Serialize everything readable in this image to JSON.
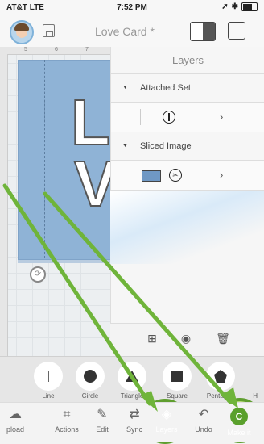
{
  "status_bar": {
    "carrier": "AT&T LTE",
    "time": "7:52 PM"
  },
  "header": {
    "title": "Love Card *"
  },
  "ruler": {
    "marks": [
      "5",
      "6",
      "7"
    ]
  },
  "canvas": {
    "letters": [
      "L",
      "V"
    ]
  },
  "layers_panel": {
    "title": "Layers",
    "groups": [
      {
        "label": "Attached Set"
      },
      {
        "label": "Sliced Image"
      }
    ]
  },
  "shapes": [
    "Line",
    "Circle",
    "Triangle",
    "Square",
    "Pentagon",
    "H"
  ],
  "toolbar": [
    "pload",
    "Actions",
    "Edit",
    "Sync",
    "Layers",
    "Undo",
    "Make it"
  ],
  "colors": {
    "highlight_green": "#5f9e2f",
    "card_blue": "#8fb3d6",
    "accent_green": "#5aa02c"
  },
  "icons": [
    "avatar",
    "save-icon",
    "split-view-icon",
    "fullscreen-icon",
    "attach-icon",
    "weld-icon",
    "chevron-right-icon",
    "layers-icon",
    "make-it-icon"
  ]
}
